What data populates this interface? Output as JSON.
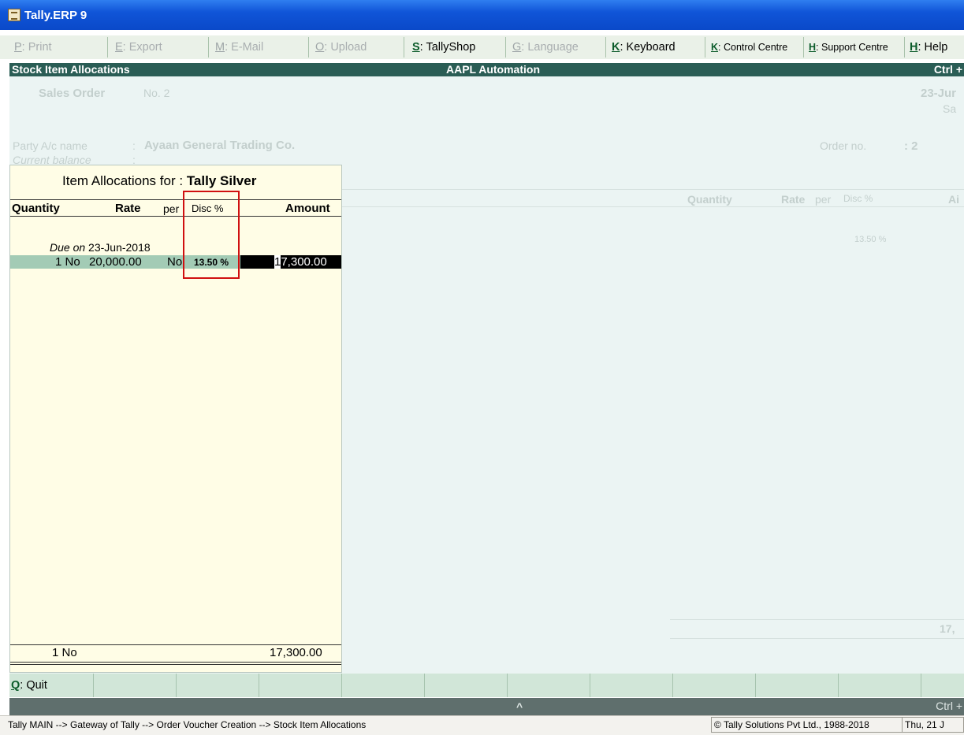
{
  "window": {
    "title": "Tally.ERP 9"
  },
  "toolbar": {
    "print": {
      "key": "P",
      "label": ": Print"
    },
    "export": {
      "key": "E",
      "label": ": Export"
    },
    "email": {
      "key": "M",
      "label": ": E-Mail"
    },
    "upload": {
      "key": "O",
      "label": ": Upload"
    },
    "tallyshop": {
      "key": "S",
      "label": ": TallyShop"
    },
    "language": {
      "key": "G",
      "label": ": Language"
    },
    "keyboard": {
      "key": "K",
      "label": ": Keyboard"
    },
    "control_centre": {
      "key": "K",
      "label": ": Control Centre"
    },
    "support_centre": {
      "key": "H",
      "label": ": Support Centre"
    },
    "help": {
      "key": "H",
      "label": ": Help"
    }
  },
  "header": {
    "screen": "Stock Item Allocations",
    "company": "AAPL Automation",
    "shortcut": "Ctrl +"
  },
  "voucher": {
    "type": "Sales Order",
    "number": "No. 2",
    "date": "23-Jur",
    "day": "Sa",
    "party_label": "Party A/c name",
    "party_sep": ":",
    "party_name": "Ayaan General Trading Co.",
    "balance_label": "Current balance",
    "balance_sep": ":",
    "order_label": "Order no.",
    "order_value": ": 2",
    "columns": {
      "quantity": "Quantity",
      "rate": "Rate",
      "per": "per",
      "disc": "Disc %",
      "amount": "Ai"
    },
    "disc_value": "13.50 %",
    "total": "17,"
  },
  "allocations": {
    "title_prefix": "Item Allocations for :",
    "item_name": "Tally Silver",
    "columns": {
      "quantity": "Quantity",
      "rate": "Rate",
      "per": "per",
      "disc": "Disc %",
      "amount": "Amount"
    },
    "due_label": "Due on",
    "due_date": "23-Jun-2018",
    "row": {
      "quantity": "1 No",
      "rate": "20,000.00",
      "per": "No",
      "disc": "13.50 %",
      "amount_cursor": "1",
      "amount_rest": "7,300.00"
    },
    "total_quantity": "1 No",
    "total_amount": "17,300.00"
  },
  "bottom": {
    "quit_key": "Q",
    "quit_label": ": Quit",
    "up_arrow": "^",
    "shortcut": "Ctrl +"
  },
  "statusbar": {
    "path": "Tally MAIN --> Gateway of Tally --> Order Voucher Creation  --> Stock Item Allocations",
    "copyright": "© Tally Solutions Pvt Ltd., 1988-2018",
    "date": "Thu, 21 J"
  }
}
